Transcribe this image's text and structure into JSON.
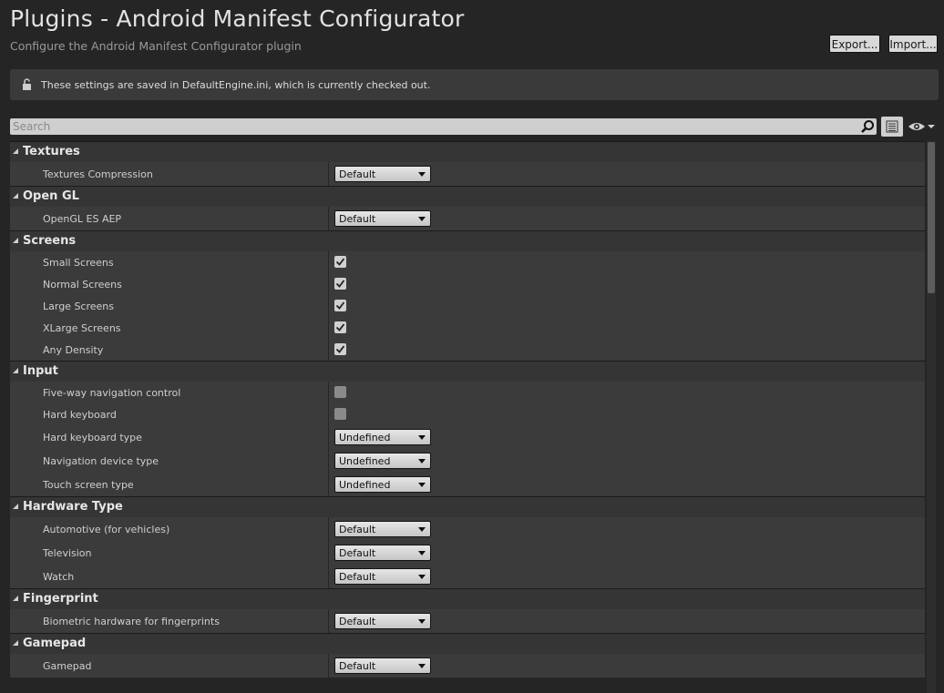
{
  "header": {
    "title": "Plugins - Android Manifest Configurator",
    "subtitle": "Configure the Android Manifest Configurator plugin",
    "export_label": "Export...",
    "import_label": "Import..."
  },
  "notice": {
    "text": "These settings are saved in DefaultEngine.ini, which is currently checked out."
  },
  "search": {
    "placeholder": "Search"
  },
  "categories": [
    {
      "name": "Textures",
      "rows": [
        {
          "label": "Textures Compression",
          "type": "dropdown",
          "value": "Default"
        }
      ]
    },
    {
      "name": "Open GL",
      "rows": [
        {
          "label": "OpenGL ES AEP",
          "type": "dropdown",
          "value": "Default"
        }
      ]
    },
    {
      "name": "Screens",
      "rows": [
        {
          "label": "Small Screens",
          "type": "checkbox",
          "checked": true
        },
        {
          "label": "Normal Screens",
          "type": "checkbox",
          "checked": true
        },
        {
          "label": "Large Screens",
          "type": "checkbox",
          "checked": true
        },
        {
          "label": "XLarge Screens",
          "type": "checkbox",
          "checked": true
        },
        {
          "label": "Any Density",
          "type": "checkbox",
          "checked": true
        }
      ]
    },
    {
      "name": "Input",
      "rows": [
        {
          "label": "Five-way navigation control",
          "type": "checkbox",
          "checked": false
        },
        {
          "label": "Hard keyboard",
          "type": "checkbox",
          "checked": false
        },
        {
          "label": "Hard keyboard type",
          "type": "dropdown",
          "value": "Undefined"
        },
        {
          "label": "Navigation device type",
          "type": "dropdown",
          "value": "Undefined"
        },
        {
          "label": "Touch screen type",
          "type": "dropdown",
          "value": "Undefined"
        }
      ]
    },
    {
      "name": "Hardware Type",
      "rows": [
        {
          "label": "Automotive (for vehicles)",
          "type": "dropdown",
          "value": "Default"
        },
        {
          "label": "Television",
          "type": "dropdown",
          "value": "Default"
        },
        {
          "label": "Watch",
          "type": "dropdown",
          "value": "Default"
        }
      ]
    },
    {
      "name": "Fingerprint",
      "rows": [
        {
          "label": "Biometric hardware for fingerprints",
          "type": "dropdown",
          "value": "Default"
        }
      ]
    },
    {
      "name": "Gamepad",
      "rows": [
        {
          "label": "Gamepad",
          "type": "dropdown",
          "value": "Default"
        }
      ]
    }
  ]
}
